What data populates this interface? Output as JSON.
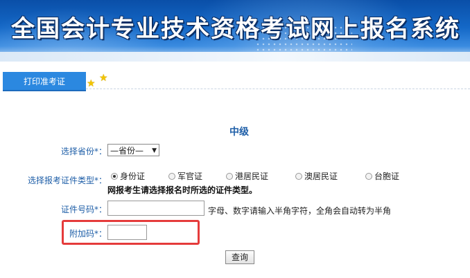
{
  "banner": {
    "title": "全国会计专业技术资格考试网上报名系统"
  },
  "tab": {
    "label": "打印准考证"
  },
  "form": {
    "level_title": "中级",
    "province": {
      "label": "选择省份",
      "required": "*：",
      "selected": "—省份—"
    },
    "id_type": {
      "label": "选择报考证件类型",
      "required": "*：",
      "options": [
        "身份证",
        "军官证",
        "港居民证",
        "澳居民证",
        "台胞证"
      ],
      "selected_index": 0,
      "note": "网报考生请选择报名时所选的证件类型。"
    },
    "id_number": {
      "label": "证件号码",
      "required": "*：",
      "value": "",
      "hint": "字母、数字请输入半角字符，全角会自动转为半角"
    },
    "captcha": {
      "label": "附加码",
      "required": "*：",
      "value": ""
    },
    "submit_label": "查询"
  },
  "colors": {
    "label_blue": "#1f5fa8",
    "tab_blue": "#2b88e0",
    "highlight_red": "#e53b3b",
    "star_yellow": "#f2c400"
  }
}
